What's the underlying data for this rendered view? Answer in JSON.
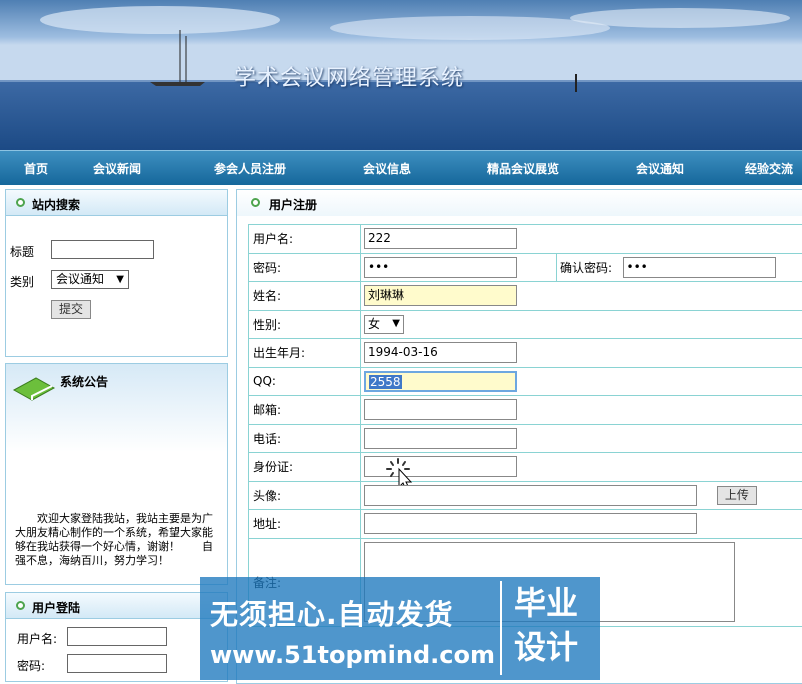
{
  "header": {
    "title": "学术会议网络管理系统"
  },
  "nav": [
    {
      "label": "首页"
    },
    {
      "label": "会议新闻"
    },
    {
      "label": "参会人员注册"
    },
    {
      "label": "会议信息"
    },
    {
      "label": "精品会议展览"
    },
    {
      "label": "会议通知"
    },
    {
      "label": "经验交流"
    }
  ],
  "search": {
    "title": "站内搜索",
    "title_label": "标题",
    "category_label": "类别",
    "category_value": "会议通知",
    "submit_label": "提交"
  },
  "announcement": {
    "title": "系统公告",
    "text": "欢迎大家登陆我站，我站主要是为广大朋友精心制作的一个系统，希望大家能够在我站获得一个好心情，谢谢！　　自强不息，海纳百川，努力学习！"
  },
  "login": {
    "title": "用户登陆",
    "username_label": "用户名:",
    "password_label": "密码:"
  },
  "register": {
    "title": "用户注册",
    "fields": {
      "username": {
        "label": "用户名:",
        "value": "222"
      },
      "password": {
        "label": "密码:",
        "value": "•••"
      },
      "confirm_password": {
        "label": "确认密码:",
        "value": "•••"
      },
      "name": {
        "label": "姓名:",
        "value": "刘琳琳"
      },
      "gender": {
        "label": "性别:",
        "value": "女"
      },
      "birth": {
        "label": "出生年月:",
        "value": "1994-03-16"
      },
      "qq": {
        "label": "QQ:",
        "value": "2558"
      },
      "email": {
        "label": "邮箱:",
        "value": ""
      },
      "phone": {
        "label": "电话:",
        "value": ""
      },
      "id_card": {
        "label": "身份证:",
        "value": ""
      },
      "avatar": {
        "label": "头像:",
        "value": "",
        "upload_label": "上传"
      },
      "address": {
        "label": "地址:",
        "value": ""
      },
      "remark": {
        "label": "备注:",
        "value": ""
      }
    }
  },
  "watermark": {
    "line1": "无须担心.自动发货",
    "line2": "www.51topmind.com",
    "badge": "毕业设计"
  }
}
